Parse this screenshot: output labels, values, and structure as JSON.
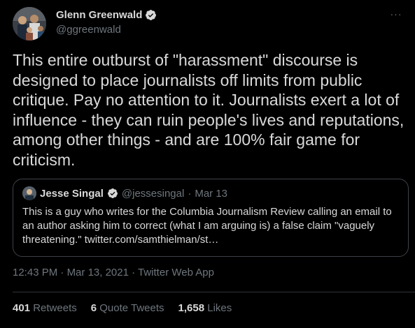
{
  "author": {
    "display_name": "Glenn Greenwald",
    "handle": "@ggreenwald"
  },
  "more_icon_glyph": "···",
  "tweet_text": "This entire outburst of \"harassment\" discourse is designed to place journalists off limits from public critique. Pay no attention to it. Journalists exert a lot of influence - they can ruin people's lives and reputations, among other things - and are 100% fair game for criticism.",
  "quoted": {
    "display_name": "Jesse Singal",
    "handle": "@jessesingal",
    "separator": "·",
    "date": "Mar 13",
    "text": "This is a guy who writes for the Columbia Journalism Review calling an email to an author asking him to correct (what I am arguing is) a false claim \"vaguely threatening.\" twitter.com/samthielman/st…"
  },
  "meta": {
    "time": "12:43 PM",
    "sep1": " · ",
    "date": "Mar 13, 2021",
    "sep2": " · ",
    "source": "Twitter Web App"
  },
  "stats": {
    "retweets_count": "401",
    "retweets_label": "Retweets",
    "quotes_count": "6",
    "quotes_label": "Quote Tweets",
    "likes_count": "1,658",
    "likes_label": "Likes"
  },
  "colors": {
    "background": "#000000",
    "text": "#d9d9d9",
    "secondary": "#6e767d",
    "border": "#3d4248",
    "verified_badge": "#d9d9d9"
  },
  "icons": {
    "verified": "verified-badge-icon",
    "more": "more-options-icon"
  }
}
